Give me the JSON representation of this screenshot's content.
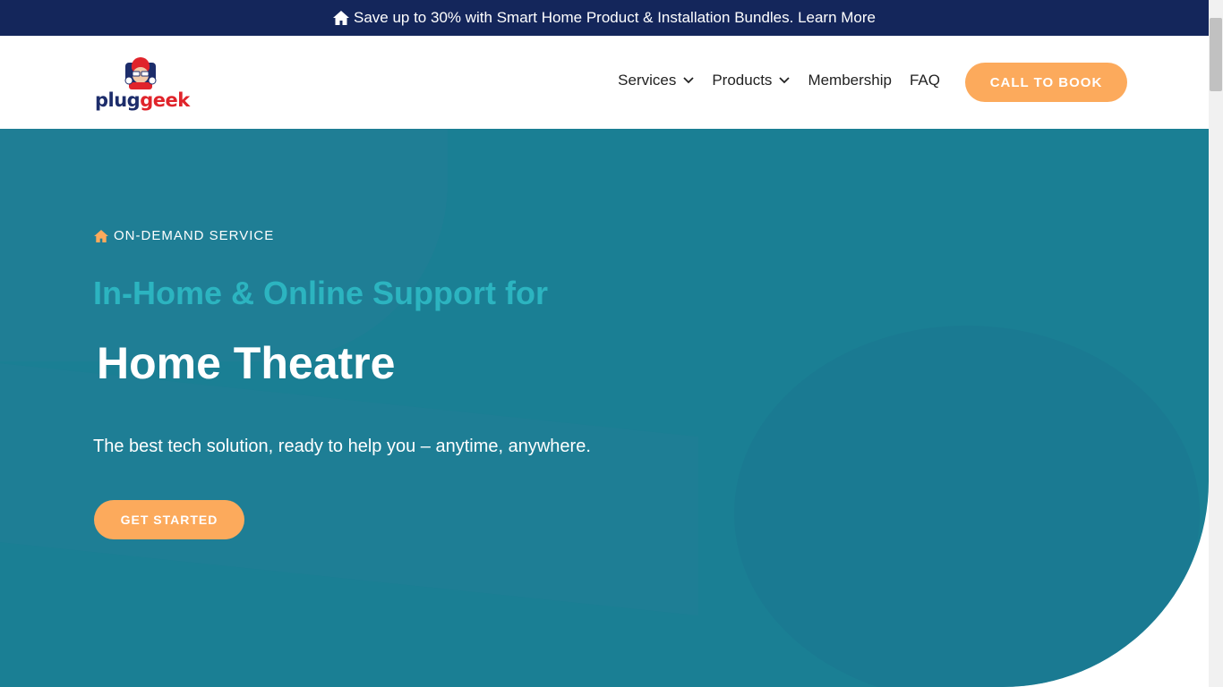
{
  "announcement": {
    "text": "Save up to 30% with Smart Home Product & Installation Bundles. Learn More"
  },
  "logo": {
    "part1": "plug",
    "part2": "geek"
  },
  "nav": {
    "items": [
      {
        "label": "Services",
        "dropdown": true
      },
      {
        "label": "Products",
        "dropdown": true
      },
      {
        "label": "Membership",
        "dropdown": false
      },
      {
        "label": "FAQ",
        "dropdown": false
      }
    ],
    "cta": "CALL TO BOOK"
  },
  "hero": {
    "eyebrow": "ON-DEMAND SERVICE",
    "subtitle": "In-Home & Online Support for",
    "title": "Home Theatre",
    "lead": "The best tech solution, ready to help you – anytime, anywhere.",
    "button": "GET STARTED"
  },
  "colors": {
    "accent": "#fcaa5c",
    "navy": "#14265b",
    "teal": "#1a7f94",
    "teal_text": "#2cb4c0"
  }
}
